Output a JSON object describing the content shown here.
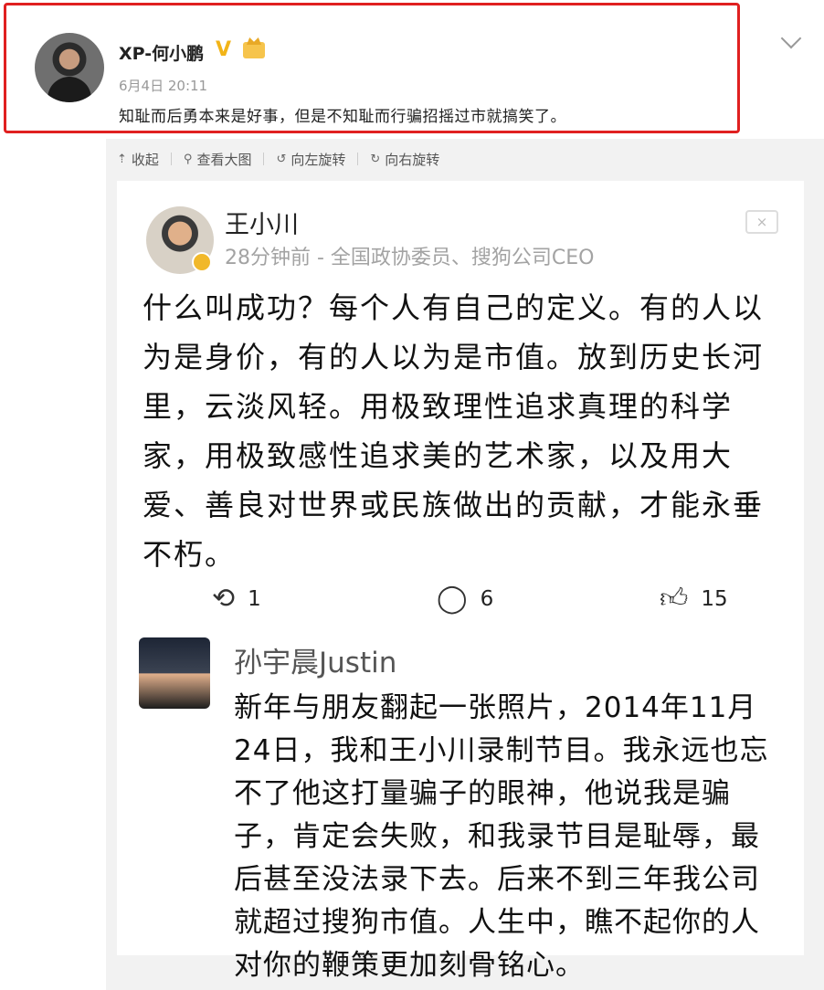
{
  "post": {
    "user_name": "XP-何小鹏",
    "time": "6月4日 20:11",
    "text": "知耻而后勇本来是好事，但是不知耻而行骗招摇过市就搞笑了。"
  },
  "toolbar": {
    "collapse_label": "收起",
    "view_large_label": "查看大图",
    "rotate_left_label": "向左旋转",
    "rotate_right_label": "向右旋转"
  },
  "embedded": {
    "name": "王小川",
    "meta": "28分钟前 - 全国政协委员、搜狗公司CEO",
    "close_label": "×",
    "body": "什么叫成功？每个人有自己的定义。有的人以为是身价，有的人以为是市值。放到历史长河里，云淡风轻。用极致理性追求真理的科学家，用极致感性追求美的艺术家，以及用大爱、善良对世界或民族做出的贡献，才能永垂不朽。",
    "reposts": "1",
    "comments": "6",
    "likes": "15",
    "reply": {
      "name": "孙宇晨Justin",
      "body": "新年与朋友翻起一张照片，2014年11月24日，我和王小川录制节目。我永远也忘不了他这打量骗子的眼神，他说我是骗子，肯定会失败，和我录节目是耻辱，最后甚至没法录下去。后来不到三年我公司就超过搜狗市值。人生中，瞧不起你的人对你的鞭策更加刻骨铭心。"
    }
  },
  "colors": {
    "highlight": "#e02020",
    "verified": "#f2b418"
  }
}
